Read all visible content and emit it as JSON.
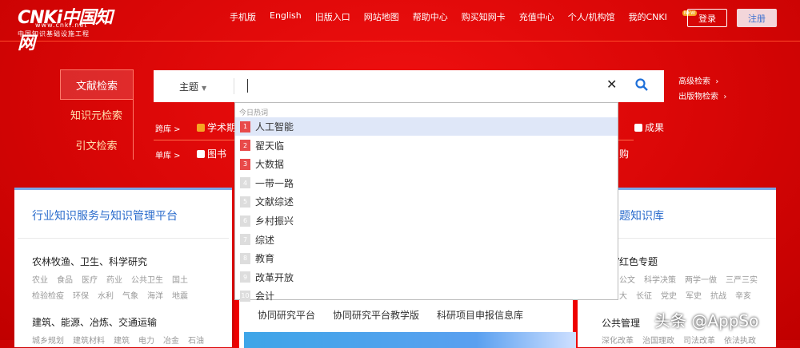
{
  "header": {
    "logo_text": "CNKi中国知网",
    "logo_url": "www.cnki.net",
    "logo_sub": "中国知识基础设施工程",
    "nav": [
      "手机版",
      "English",
      "旧版入口",
      "网站地图",
      "帮助中心",
      "购买知网卡",
      "充值中心",
      "个人/机构馆",
      "我的CNKI"
    ],
    "new_badge": "NEW",
    "login": "登录",
    "register": "注册"
  },
  "tabs": [
    "文献检索",
    "知识元检索",
    "引文检索"
  ],
  "search": {
    "field": "主题",
    "value": "",
    "advanced": "高级检索",
    "publication": "出版物检索"
  },
  "filters": {
    "cross_label": "跨库 >",
    "single_label": "单库 >",
    "cross_items": [
      "学术期",
      "成果"
    ],
    "single_items": [
      "图书",
      "购"
    ]
  },
  "dropdown": {
    "header": "今日热词",
    "items": [
      {
        "rank": "1",
        "text": "人工智能"
      },
      {
        "rank": "2",
        "text": "翟天临"
      },
      {
        "rank": "3",
        "text": "大数据"
      },
      {
        "rank": "4",
        "text": "一带一路"
      },
      {
        "rank": "5",
        "text": "文献综述"
      },
      {
        "rank": "6",
        "text": "乡村振兴"
      },
      {
        "rank": "7",
        "text": "综述"
      },
      {
        "rank": "8",
        "text": "教育"
      },
      {
        "rank": "9",
        "text": "改革开放"
      },
      {
        "rank": "10",
        "text": "会计"
      }
    ]
  },
  "left_card": {
    "title": "行业知识服务与知识管理平台",
    "groups": [
      {
        "name": "农林牧渔、卫生、科学研究",
        "rows": [
          [
            "农业",
            "食品",
            "医疗",
            "药业",
            "公共卫生",
            "国土"
          ],
          [
            "检验检疫",
            "环保",
            "水利",
            "气象",
            "海洋",
            "地震"
          ]
        ]
      },
      {
        "name": "建筑、能源、冶炼、交通运输",
        "rows": [
          [
            "城乡规划",
            "建筑材料",
            "建筑",
            "电力",
            "冶金",
            "石油"
          ]
        ]
      }
    ]
  },
  "middle_card": {
    "links": [
      "协同研究平台",
      "协同研究平台教学版",
      "科研项目申报信息库"
    ]
  },
  "right_card": {
    "title": "题知识库",
    "groups": [
      {
        "name": "/红色专题",
        "rows": [
          [
            "公文",
            "科学决策",
            "两学一做",
            "三严三实"
          ],
          [
            "大",
            "长征",
            "党史",
            "军史",
            "抗战",
            "辛亥"
          ]
        ]
      },
      {
        "name": "公共管理",
        "rows": [
          [
            "深化改革",
            "治国理政",
            "司法改革",
            "依法执政"
          ]
        ]
      }
    ]
  },
  "watermark": "头条 @AppSo"
}
